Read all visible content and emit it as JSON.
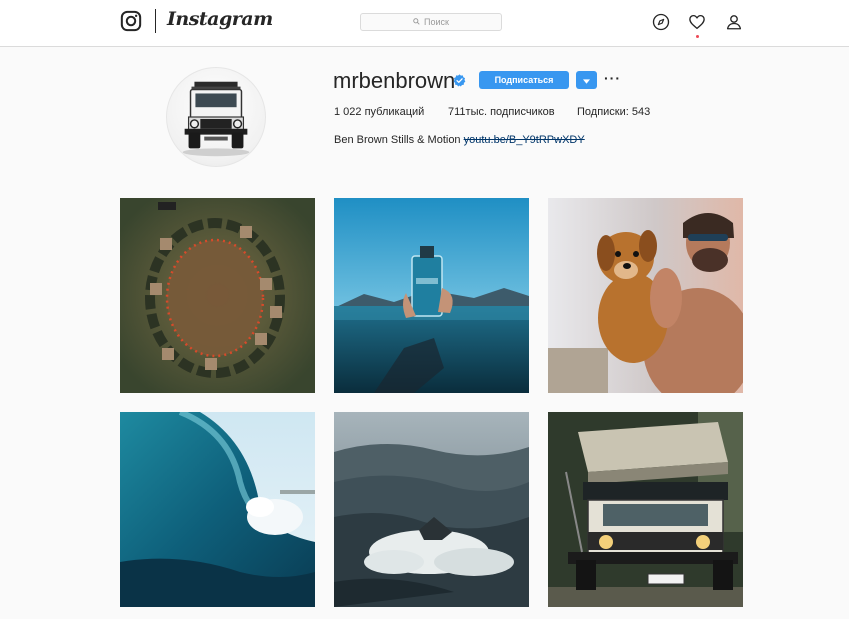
{
  "nav": {
    "wordmark": "Instagram",
    "search_placeholder": "Поиск",
    "icons": [
      "instagram-logo-icon",
      "compass-icon",
      "heart-icon",
      "person-icon"
    ]
  },
  "profile": {
    "username": "mrbenbrown",
    "verified": true,
    "follow_label": "Подписаться",
    "more_label": "···",
    "stats": {
      "posts": "1 022 публикаций",
      "followers": "711тыс. подписчиков",
      "following": "Подписки: 543"
    },
    "bio_name": "Ben Brown Stills & Motion",
    "bio_link": "youtu.be/B_Y9tRPwXDY"
  },
  "colors": {
    "accent": "#3897f0",
    "link": "#003569",
    "border": "#dbdbdb",
    "background": "#fafafa"
  },
  "posts": [
    {
      "subject": "aerial-stone-circle"
    },
    {
      "subject": "perfume-bottle-ocean"
    },
    {
      "subject": "man-holding-puppy"
    },
    {
      "subject": "breaking-wave"
    },
    {
      "subject": "mountains-above-clouds"
    },
    {
      "subject": "land-rover-roof-tent"
    }
  ]
}
